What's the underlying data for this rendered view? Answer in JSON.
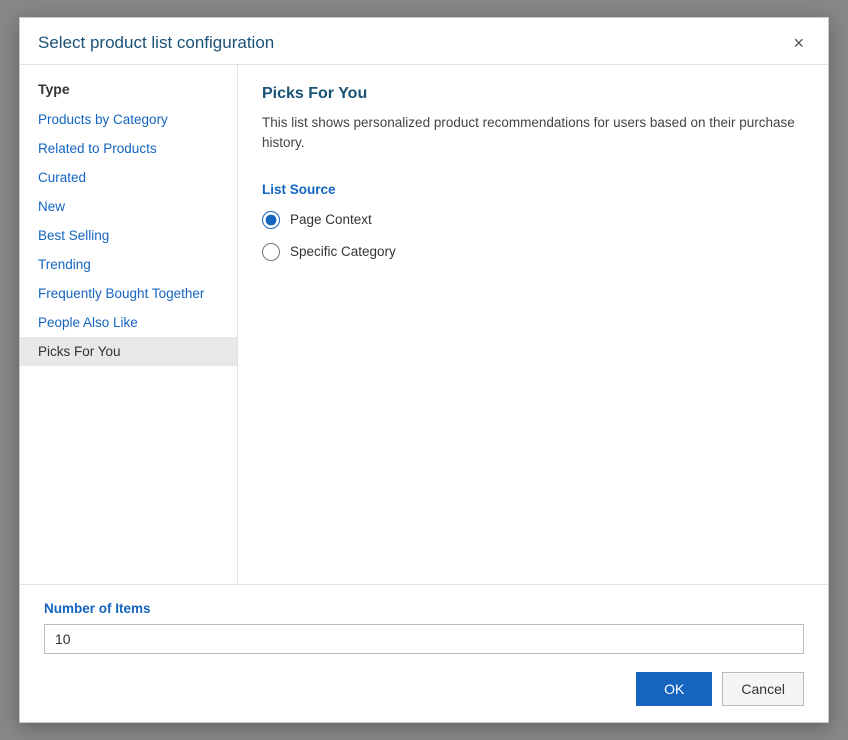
{
  "dialog": {
    "title": "Select product list configuration",
    "close_label": "×"
  },
  "sidebar": {
    "header": "Type",
    "items": [
      {
        "label": "Products by Category",
        "active": false
      },
      {
        "label": "Related to Products",
        "active": false
      },
      {
        "label": "Curated",
        "active": false
      },
      {
        "label": "New",
        "active": false
      },
      {
        "label": "Best Selling",
        "active": false
      },
      {
        "label": "Trending",
        "active": false
      },
      {
        "label": "Frequently Bought Together",
        "active": false
      },
      {
        "label": "People Also Like",
        "active": false
      },
      {
        "label": "Picks For You",
        "active": true
      }
    ]
  },
  "main": {
    "title": "Picks For You",
    "description": "This list shows personalized product recommendations for users based on their purchase history.",
    "list_source_label": "List Source",
    "radio_options": [
      {
        "label": "Page Context",
        "checked": true,
        "id": "page-context"
      },
      {
        "label": "Specific Category",
        "checked": false,
        "id": "specific-category"
      }
    ]
  },
  "footer": {
    "number_of_items_label": "Number of Items",
    "number_of_items_value": "10",
    "ok_label": "OK",
    "cancel_label": "Cancel"
  }
}
